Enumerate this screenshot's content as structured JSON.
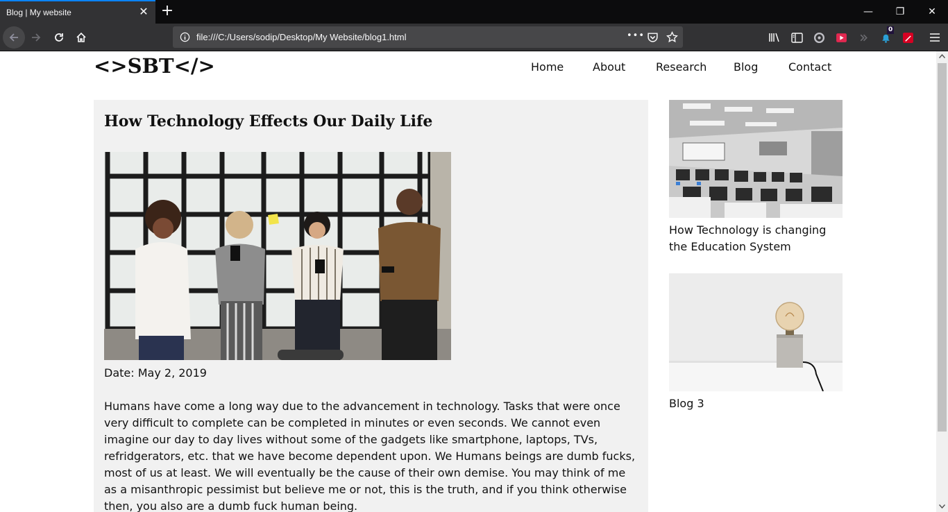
{
  "browser": {
    "tab_title": "Blog | My website",
    "tab_close_glyph": "✕",
    "new_tab_glyph": "+",
    "url": "file:///C:/Users/sodip/Desktop/My Website/blog1.html",
    "page_actions_glyph": "•••",
    "notification_count": "0",
    "window_controls": {
      "minimize": "—",
      "restore": "❐",
      "close": "✕"
    }
  },
  "site": {
    "logo": "<>SBT</>",
    "nav": [
      "Home",
      "About",
      "Research",
      "Blog",
      "Contact"
    ]
  },
  "article": {
    "title": "How Technology Effects Our Daily Life",
    "date": "Date: May 2, 2019",
    "body": "Humans have come a long way due to the advancement in technology. Tasks that were once very difficult to complete can be completed in minutes or even seconds. We cannot even imagine our day to day lives without some of the gadgets like smartphone, laptops, TVs, refridgerators, etc. that we have become dependent upon. We Humans beings are dumb fucks, most of us at least. We will eventually be the cause of their own demise. You may think of me as a misanthropic pessimist but believe me or not, this is the truth, and if you think otherwise then, you also are a dumb fuck human being."
  },
  "sidebar": {
    "posts": [
      {
        "caption": "How Technology is changing the Education System"
      },
      {
        "caption": "Blog 3"
      }
    ]
  },
  "colors": {
    "tab_accent": "#0a84ff",
    "chrome_dark": "#0c0c0d",
    "chrome_mid": "#323234",
    "article_bg": "#f1f1f1"
  }
}
